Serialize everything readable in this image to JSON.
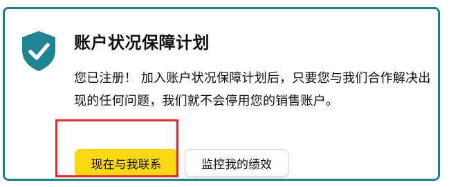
{
  "card": {
    "title": "账户状况保障计划",
    "description": "您已注册！ 加入账户状况保障计划后，只要您与我们合作解决出现的任何问题，我们就不会停用您的销售账户。",
    "icon": "shield-check-icon"
  },
  "actions": {
    "contact_label": "现在与我联系",
    "monitor_label": "监控我的绩效"
  },
  "colors": {
    "accent": "#1f8391",
    "primary_button": "#ffd814",
    "annotation": "#e8262a"
  }
}
